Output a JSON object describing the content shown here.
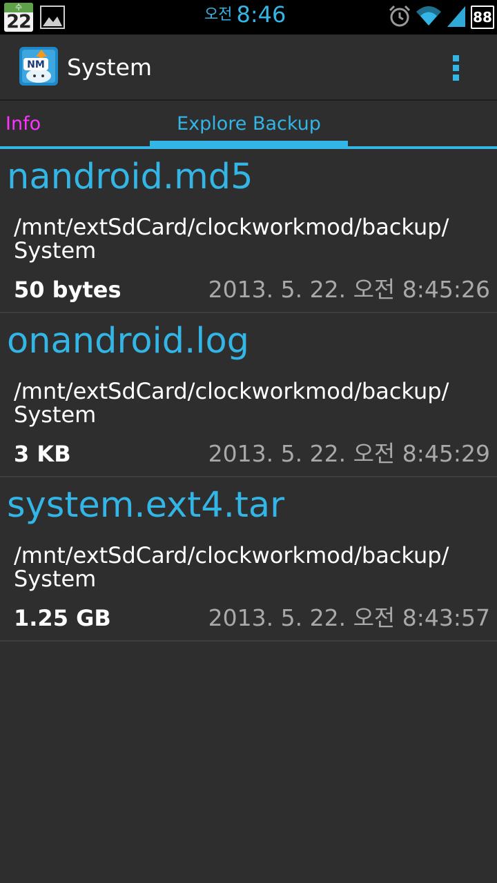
{
  "statusbar": {
    "calendar_weekday": "수",
    "calendar_day": "22",
    "clock_ampm": "오전",
    "clock_time": "8:46",
    "battery_level": "88"
  },
  "actionbar": {
    "title": "System",
    "icon_text": "NM"
  },
  "tabs": [
    {
      "label": "Info",
      "selected": false
    },
    {
      "label": "Explore Backup",
      "selected": true
    }
  ],
  "files": [
    {
      "name": "nandroid.md5",
      "path": "/mnt/extSdCard/clockworkmod/backup/\nSystem",
      "size": "50 bytes",
      "date": "2013. 5. 22. 오전 8:45:26"
    },
    {
      "name": "onandroid.log",
      "path": "/mnt/extSdCard/clockworkmod/backup/\nSystem",
      "size": "3 KB",
      "date": "2013. 5. 22. 오전 8:45:29"
    },
    {
      "name": "system.ext4.tar",
      "path": "/mnt/extSdCard/clockworkmod/backup/\nSystem",
      "size": "1.25 GB",
      "date": "2013. 5. 22. 오전 8:43:57"
    }
  ],
  "colors": {
    "accent": "#33b5e5",
    "info_tab": "#ff33ff",
    "background": "#2e2e2e"
  }
}
